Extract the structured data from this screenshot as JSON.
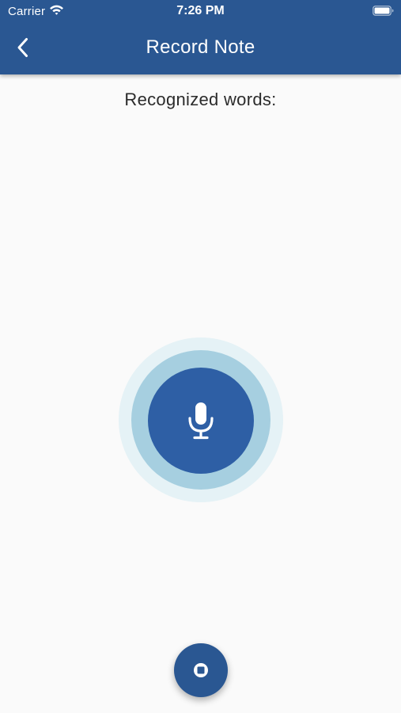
{
  "status_bar": {
    "carrier": "Carrier",
    "time": "7:26 PM"
  },
  "header": {
    "title": "Record Note",
    "back_icon": "chevron-left-icon"
  },
  "main": {
    "recognized_label": "Recognized words:",
    "mic_icon": "microphone-icon",
    "stop_icon": "stop-icon"
  },
  "colors": {
    "primary": "#2a5792",
    "mic_button": "#2e5fa5",
    "ring_inner": "#a6cfe0",
    "ring_outer": "#e5f2f6",
    "background": "#fafafa"
  }
}
